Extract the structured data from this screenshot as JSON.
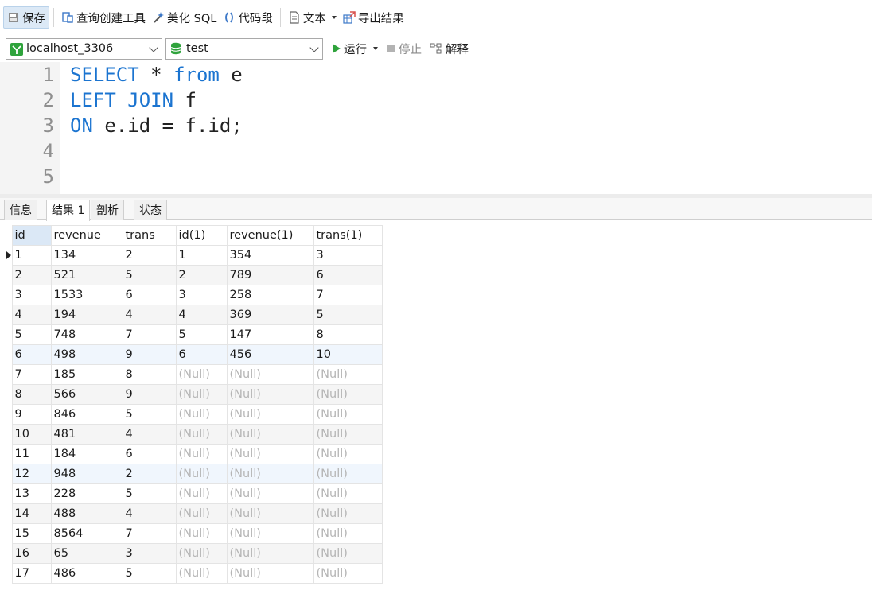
{
  "toolbar": {
    "save": "保存",
    "query_builder": "查询创建工具",
    "beautify": "美化 SQL",
    "snippet": "代码段",
    "text": "文本",
    "export": "导出结果"
  },
  "toolbar2": {
    "connection": "localhost_3306",
    "database": "test",
    "run": "运行",
    "stop": "停止",
    "explain": "解释"
  },
  "editor": {
    "lines": [
      {
        "n": "1",
        "tokens": [
          {
            "t": "SELECT",
            "k": 1
          },
          {
            "t": " * ",
            "k": 0
          },
          {
            "t": "from",
            "k": 1
          },
          {
            "t": " e",
            "k": 0
          }
        ]
      },
      {
        "n": "2",
        "tokens": [
          {
            "t": "LEFT JOIN",
            "k": 1
          },
          {
            "t": " f",
            "k": 0
          }
        ]
      },
      {
        "n": "3",
        "tokens": [
          {
            "t": "ON",
            "k": 1
          },
          {
            "t": " e.id = f.id;",
            "k": 0
          }
        ]
      },
      {
        "n": "4",
        "tokens": []
      },
      {
        "n": "5",
        "tokens": []
      }
    ]
  },
  "tabs": [
    "信息",
    "结果 1",
    "剖析",
    "状态"
  ],
  "grid": {
    "columns": [
      "id",
      "revenue",
      "trans",
      "id(1)",
      "revenue(1)",
      "trans(1)"
    ],
    "rows": [
      [
        "1",
        "134",
        "2",
        "1",
        "354",
        "3"
      ],
      [
        "2",
        "521",
        "5",
        "2",
        "789",
        "6"
      ],
      [
        "3",
        "1533",
        "6",
        "3",
        "258",
        "7"
      ],
      [
        "4",
        "194",
        "4",
        "4",
        "369",
        "5"
      ],
      [
        "5",
        "748",
        "7",
        "5",
        "147",
        "8"
      ],
      [
        "6",
        "498",
        "9",
        "6",
        "456",
        "10"
      ],
      [
        "7",
        "185",
        "8",
        "(Null)",
        "(Null)",
        "(Null)"
      ],
      [
        "8",
        "566",
        "9",
        "(Null)",
        "(Null)",
        "(Null)"
      ],
      [
        "9",
        "846",
        "5",
        "(Null)",
        "(Null)",
        "(Null)"
      ],
      [
        "10",
        "481",
        "4",
        "(Null)",
        "(Null)",
        "(Null)"
      ],
      [
        "11",
        "184",
        "6",
        "(Null)",
        "(Null)",
        "(Null)"
      ],
      [
        "12",
        "948",
        "2",
        "(Null)",
        "(Null)",
        "(Null)"
      ],
      [
        "13",
        "228",
        "5",
        "(Null)",
        "(Null)",
        "(Null)"
      ],
      [
        "14",
        "488",
        "4",
        "(Null)",
        "(Null)",
        "(Null)"
      ],
      [
        "15",
        "8564",
        "7",
        "(Null)",
        "(Null)",
        "(Null)"
      ],
      [
        "16",
        "65",
        "3",
        "(Null)",
        "(Null)",
        "(Null)"
      ],
      [
        "17",
        "486",
        "5",
        "(Null)",
        "(Null)",
        "(Null)"
      ]
    ],
    "highlighted_rows": [
      "6",
      "12"
    ],
    "current_row": "1"
  },
  "colors": {
    "keyword": "#1b74d0",
    "null_text": "#b5b5b5",
    "run_icon": "#2fa33c"
  }
}
